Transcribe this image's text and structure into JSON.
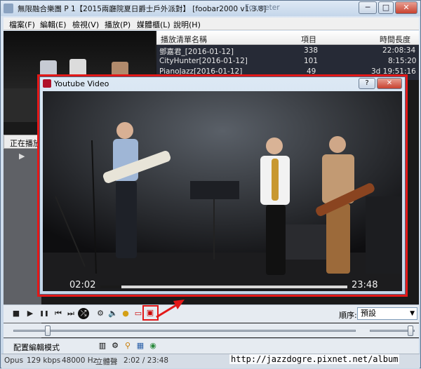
{
  "window": {
    "title": "無限融合樂團 P 1【2015兩廳院夏日爵士戶外派對】  [foobar2000 v1.3.8]",
    "ghost_title": "Foxmeter",
    "minimize": "─",
    "maximize": "□",
    "close": "✕"
  },
  "menu": [
    "檔案(F)",
    "編輯(E)",
    "檢視(V)",
    "播放(P)",
    "媒體櫃(L)",
    "說明(H)"
  ],
  "playlist": {
    "columns": {
      "name": "播放清單名稱",
      "items": "項目",
      "duration": "時間長度"
    },
    "rows": [
      {
        "name": "鄧嘉君_[2016-01-12]",
        "items": "338",
        "duration": "22:08:34"
      },
      {
        "name": "CityHunter[2016-01-12]",
        "items": "101",
        "duration": "8:15:20"
      },
      {
        "name": "PianoJazz[2016-01-12]",
        "items": "49",
        "duration": "3d 19:51:16"
      }
    ]
  },
  "now_playing_tab": "正在播放",
  "youtube_window": {
    "title": "Youtube Video",
    "help_button": "?",
    "close_button": "✕",
    "current_time": "02:02",
    "total_time": "23:48",
    "progress": 0.0854
  },
  "toolbar": {
    "stop": "■",
    "play": "▶",
    "pause": "❚❚",
    "prev": "⏮",
    "next": "⏭",
    "random": "⤮",
    "order_label": "順序:",
    "order_value": "預設"
  },
  "seek": {
    "position_fraction": 0.1,
    "volume_fraction": 0.9
  },
  "bottom": {
    "layout_button": "配置編輯模式"
  },
  "status": {
    "codec": "Opus",
    "bitrate": "129 kbps",
    "samplerate": "48000 Hz",
    "channels": "立體聲",
    "time": "2:02 / 23:48"
  },
  "watermark": "http://jazzdogre.pixnet.net/album",
  "colors": {
    "highlight": "#e31818",
    "playlist_bg": "#262a36",
    "video_bg": "#111111"
  },
  "icons": [
    "app-icon",
    "stop-icon",
    "play-icon",
    "pause-icon",
    "previous-icon",
    "next-icon",
    "random-icon",
    "settings-icon",
    "volume-icon",
    "bulb-icon",
    "record-icon",
    "youtube-icon"
  ]
}
